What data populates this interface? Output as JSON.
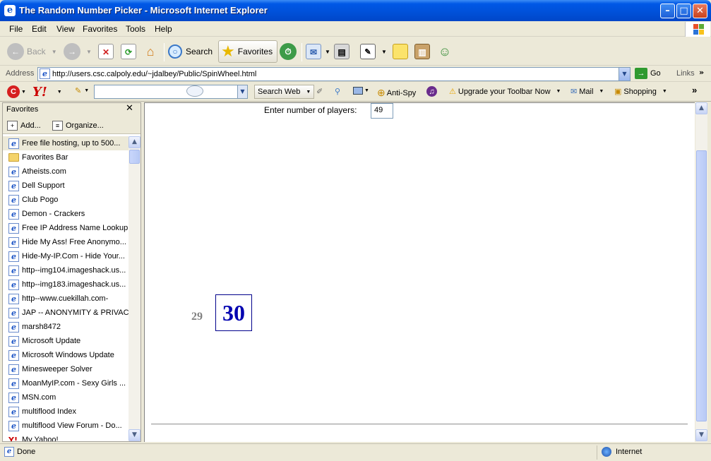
{
  "window": {
    "title": "The Random Number Picker - Microsoft Internet Explorer",
    "controls": {
      "minimize": "–",
      "maximize": "□",
      "close": "✕"
    }
  },
  "menu": [
    "File",
    "Edit",
    "View",
    "Favorites",
    "Tools",
    "Help"
  ],
  "toolbar": {
    "back": "Back",
    "search": "Search",
    "favorites": "Favorites"
  },
  "address": {
    "label": "Address",
    "url": "http://users.csc.calpoly.edu/~jdalbey/Public/SpinWheel.html",
    "go": "Go",
    "links": "Links"
  },
  "yahoo_toolbar": {
    "search_web": "Search Web",
    "anti_spy": "Anti-Spy",
    "upgrade": "Upgrade your Toolbar Now",
    "mail": "Mail",
    "shopping": "Shopping"
  },
  "favorites_pane": {
    "title": "Favorites",
    "close": "✕",
    "add": "Add...",
    "organize": "Organize...",
    "items": [
      {
        "label": "Free file hosting, up to 500...",
        "icon": "ie-icon"
      },
      {
        "label": "Favorites Bar",
        "icon": "folder-icon"
      },
      {
        "label": "Atheists.com",
        "icon": "ie-icon"
      },
      {
        "label": "Dell Support",
        "icon": "ie-icon"
      },
      {
        "label": "Club Pogo",
        "icon": "ie-icon"
      },
      {
        "label": "Demon - Crackers",
        "icon": "ie-icon"
      },
      {
        "label": "Free IP Address Name Lookup",
        "icon": "ie-icon"
      },
      {
        "label": "Hide My Ass! Free Anonymo...",
        "icon": "ie-icon"
      },
      {
        "label": "Hide-My-IP.Com - Hide Your...",
        "icon": "ie-icon"
      },
      {
        "label": "http--img104.imageshack.us...",
        "icon": "ie-icon"
      },
      {
        "label": "http--img183.imageshack.us...",
        "icon": "ie-icon"
      },
      {
        "label": "http--www.cuekillah.com-",
        "icon": "ie-icon"
      },
      {
        "label": "JAP -- ANONYMITY & PRIVACY",
        "icon": "ie-icon"
      },
      {
        "label": "marsh8472",
        "icon": "ie-icon"
      },
      {
        "label": "Microsoft Update",
        "icon": "ie-icon"
      },
      {
        "label": "Microsoft Windows Update",
        "icon": "ie-icon"
      },
      {
        "label": "Minesweeper Solver",
        "icon": "ie-icon"
      },
      {
        "label": "MoanMyIP.com - Sexy Girls ...",
        "icon": "ie-icon"
      },
      {
        "label": "MSN.com",
        "icon": "ie-icon"
      },
      {
        "label": "multiflood  Index",
        "icon": "ie-icon"
      },
      {
        "label": "multiflood  View Forum - Do...",
        "icon": "ie-icon"
      },
      {
        "label": "My Yahoo!",
        "icon": "yahoo-icon"
      }
    ]
  },
  "page": {
    "players_label": "Enter number of players:",
    "players_value": "49",
    "previous_number": "29",
    "current_number": "30"
  },
  "status": {
    "text": "Done",
    "zone": "Internet"
  },
  "colors": {
    "titlebar": "#0054e3",
    "current_number": "#0000b0",
    "previous_number": "#808080"
  }
}
